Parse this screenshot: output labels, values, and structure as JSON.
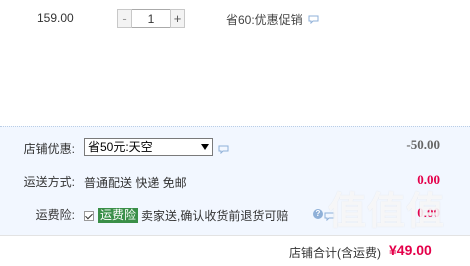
{
  "item": {
    "price": "159.00",
    "qty_minus": "-",
    "qty_value": "1",
    "qty_plus": "+",
    "promo_text": "省60:优惠促销"
  },
  "summary": {
    "shop_discount": {
      "label": "店铺优惠:",
      "selected": "省50元:天空",
      "amount": "-50.00"
    },
    "shipping": {
      "label": "运送方式:",
      "options": "普通配送 快递 免邮",
      "amount": "0.00"
    },
    "insurance": {
      "label": "运费险:",
      "tag": "运费险",
      "text": "卖家送,确认收货前退货可赔",
      "help": "?",
      "amount": "0.00"
    }
  },
  "total": {
    "label": "店铺合计(含运费)",
    "value": "¥49.00"
  },
  "watermark": "值值值",
  "colors": {
    "summary_bg": "#f2f7ff",
    "price_red": "#e4004a",
    "insurance_tag": "#3a8f48",
    "chat_icon": "#8fb0d8"
  },
  "icons": {
    "chat": "chat-bubble-icon",
    "help": "question-mark-icon"
  }
}
